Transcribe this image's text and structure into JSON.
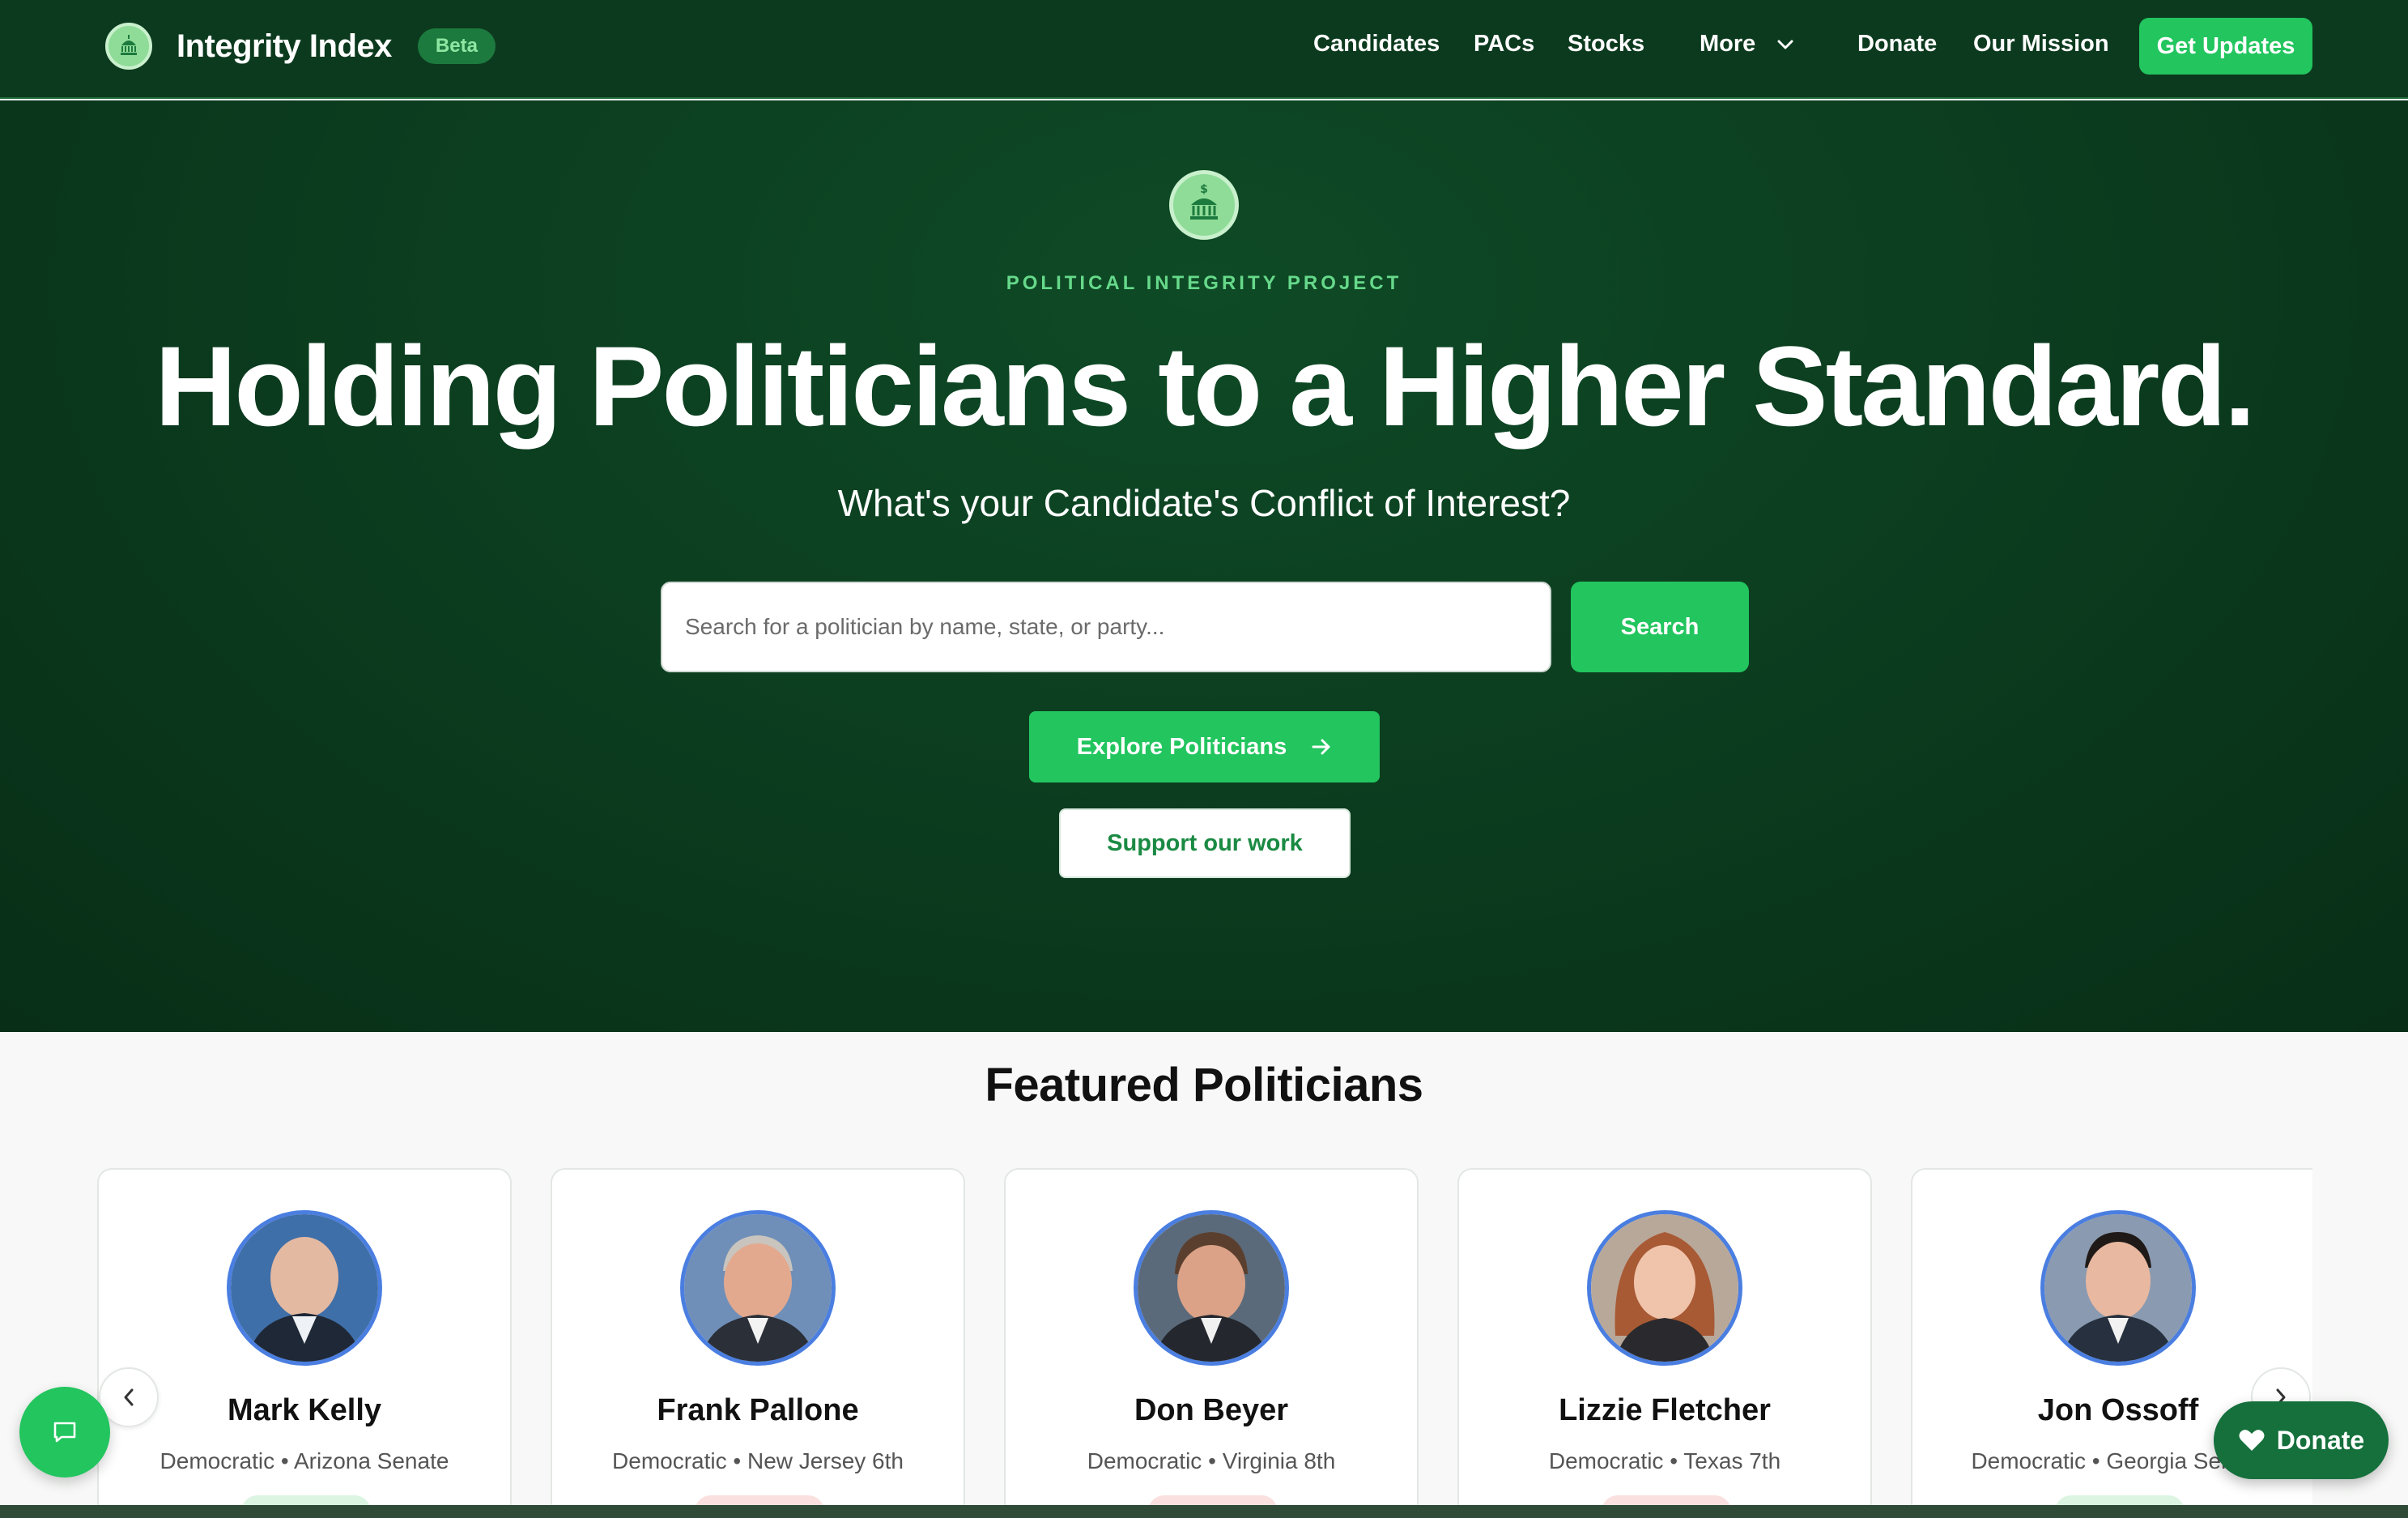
{
  "brand": {
    "name": "Integrity Index",
    "badge": "Beta"
  },
  "nav": {
    "candidates": "Candidates",
    "pacs": "PACs",
    "stocks": "Stocks",
    "more": "More",
    "donate": "Donate",
    "our_mission": "Our Mission",
    "get_updates": "Get Updates"
  },
  "hero": {
    "eyebrow": "POLITICAL INTEGRITY PROJECT",
    "headline": "Holding Politicians to a Higher Standard.",
    "subhead": "What's your Candidate's Conflict of Interest?",
    "search_placeholder": "Search for a politician by name, state, or party...",
    "search_button": "Search",
    "explore_button": "Explore Politicians",
    "support_button": "Support our work"
  },
  "featured": {
    "title": "Featured Politicians",
    "cards": [
      {
        "name": "Mark Kelly",
        "party": "Democratic",
        "office": "Arizona Senate"
      },
      {
        "name": "Frank Pallone",
        "party": "Democratic",
        "office": "New Jersey 6th"
      },
      {
        "name": "Don Beyer",
        "party": "Democratic",
        "office": "Virginia 8th"
      },
      {
        "name": "Lizzie Fletcher",
        "party": "Democratic",
        "office": "Texas 7th"
      },
      {
        "name": "Jon Ossoff",
        "party": "Democratic",
        "office": "Georgia Senate"
      }
    ]
  },
  "fab": {
    "donate": "Donate"
  },
  "colors": {
    "accent": "#22c55e",
    "nav_bg": "#0c3a1e",
    "hero_bg": "#0b3b1e",
    "avatar_ring": "#4a7ee0"
  },
  "icons": [
    "capitol-logo-icon",
    "chevron-down-icon",
    "arrow-right-icon",
    "chevron-left-icon",
    "chevron-right-icon",
    "chat-icon",
    "heart-icon"
  ]
}
